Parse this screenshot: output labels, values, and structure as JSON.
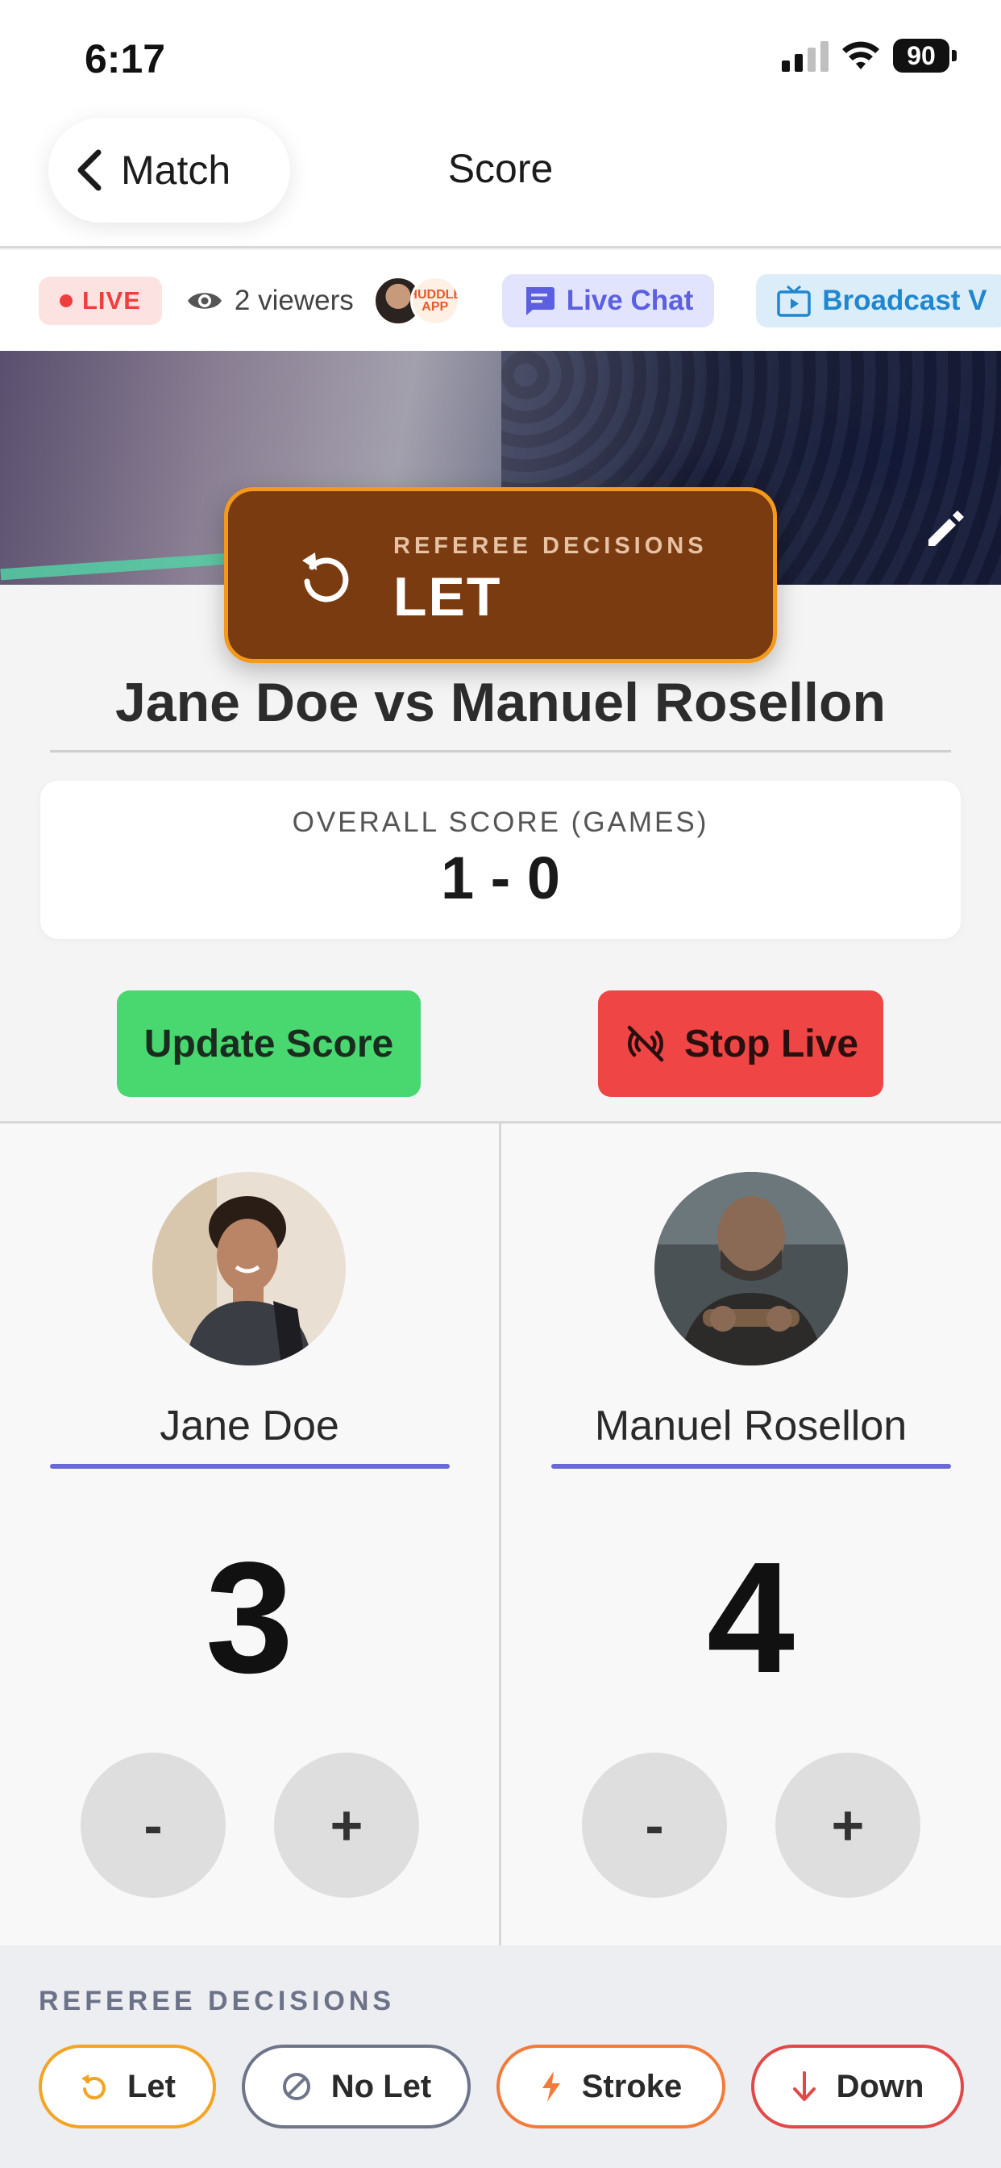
{
  "status_bar": {
    "time": "6:17",
    "battery": "90"
  },
  "nav": {
    "back_label": "Match",
    "title": "Score"
  },
  "info_strip": {
    "live_label": "LIVE",
    "viewers": "2 viewers",
    "avatar_badge": "HUDDLE APP",
    "chat_label": "Live Chat",
    "broadcast_label": "Broadcast V"
  },
  "referee_banner": {
    "subtitle": "REFEREE DECISIONS",
    "decision": "LET"
  },
  "match": {
    "title": "Jane Doe vs Manuel Rosellon"
  },
  "overall_score": {
    "label": "OVERALL SCORE (GAMES)",
    "value": "1 - 0"
  },
  "actions": {
    "update_label": "Update Score",
    "stop_label": "Stop Live"
  },
  "players": [
    {
      "name": "Jane Doe",
      "score": "3",
      "minus": "-",
      "plus": "+"
    },
    {
      "name": "Manuel Rosellon",
      "score": "4",
      "minus": "-",
      "plus": "+"
    }
  ],
  "referee_decisions": {
    "heading": "REFEREE DECISIONS",
    "items": [
      {
        "label": "Let",
        "icon": "undo-icon",
        "color": "#f3a423"
      },
      {
        "label": "No Let",
        "icon": "prohibited-icon",
        "color": "#6e7489"
      },
      {
        "label": "Stroke",
        "icon": "lightning-icon",
        "color": "#f27b3a"
      },
      {
        "label": "Down",
        "icon": "arrow-down-icon",
        "color": "#e24848"
      }
    ]
  },
  "colors": {
    "live_red": "#ef3e3e",
    "accent_indigo": "#6a68d6",
    "update_green": "#49d76f",
    "stop_red": "#ef4545",
    "banner_brown": "#7a3b11",
    "banner_border": "#f39a1d"
  }
}
